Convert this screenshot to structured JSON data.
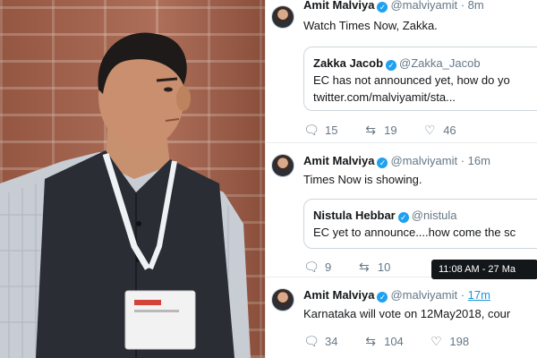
{
  "tweets": [
    {
      "name": "Amit Malviya",
      "handle": "@malviyamit",
      "time": "· 8m",
      "text": "Watch Times Now, Zakka.",
      "quote": {
        "name": "Zakka Jacob",
        "handle": "@Zakka_Jacob",
        "line1": "EC has not announced yet, how do yo",
        "line2": "twitter.com/malviyamit/sta..."
      },
      "replies": "15",
      "retweets": "19",
      "likes": "46"
    },
    {
      "name": "Amit Malviya",
      "handle": "@malviyamit",
      "time": "· 16m",
      "text": "Times Now is showing.",
      "quote": {
        "name": "Nistula Hebbar",
        "handle": "@nistula",
        "line1": "EC yet to announce....how come the sc"
      },
      "replies": "9",
      "retweets": "10"
    },
    {
      "name": "Amit Malviya",
      "handle": "@malviyamit",
      "time": "17m",
      "text": "Karnataka will vote on 12May2018, cour",
      "replies": "34",
      "retweets": "104",
      "likes": "198"
    }
  ],
  "tooltip": "11:08 AM - 27 Ma",
  "icons": {
    "reply": "reply-icon",
    "retweet": "retweet-icon",
    "like": "heart-icon",
    "verified": "verified-badge-icon"
  },
  "colors": {
    "accent": "#1da1f2",
    "text": "#14171a",
    "muted": "#657786",
    "border": "#e6ecf0"
  }
}
